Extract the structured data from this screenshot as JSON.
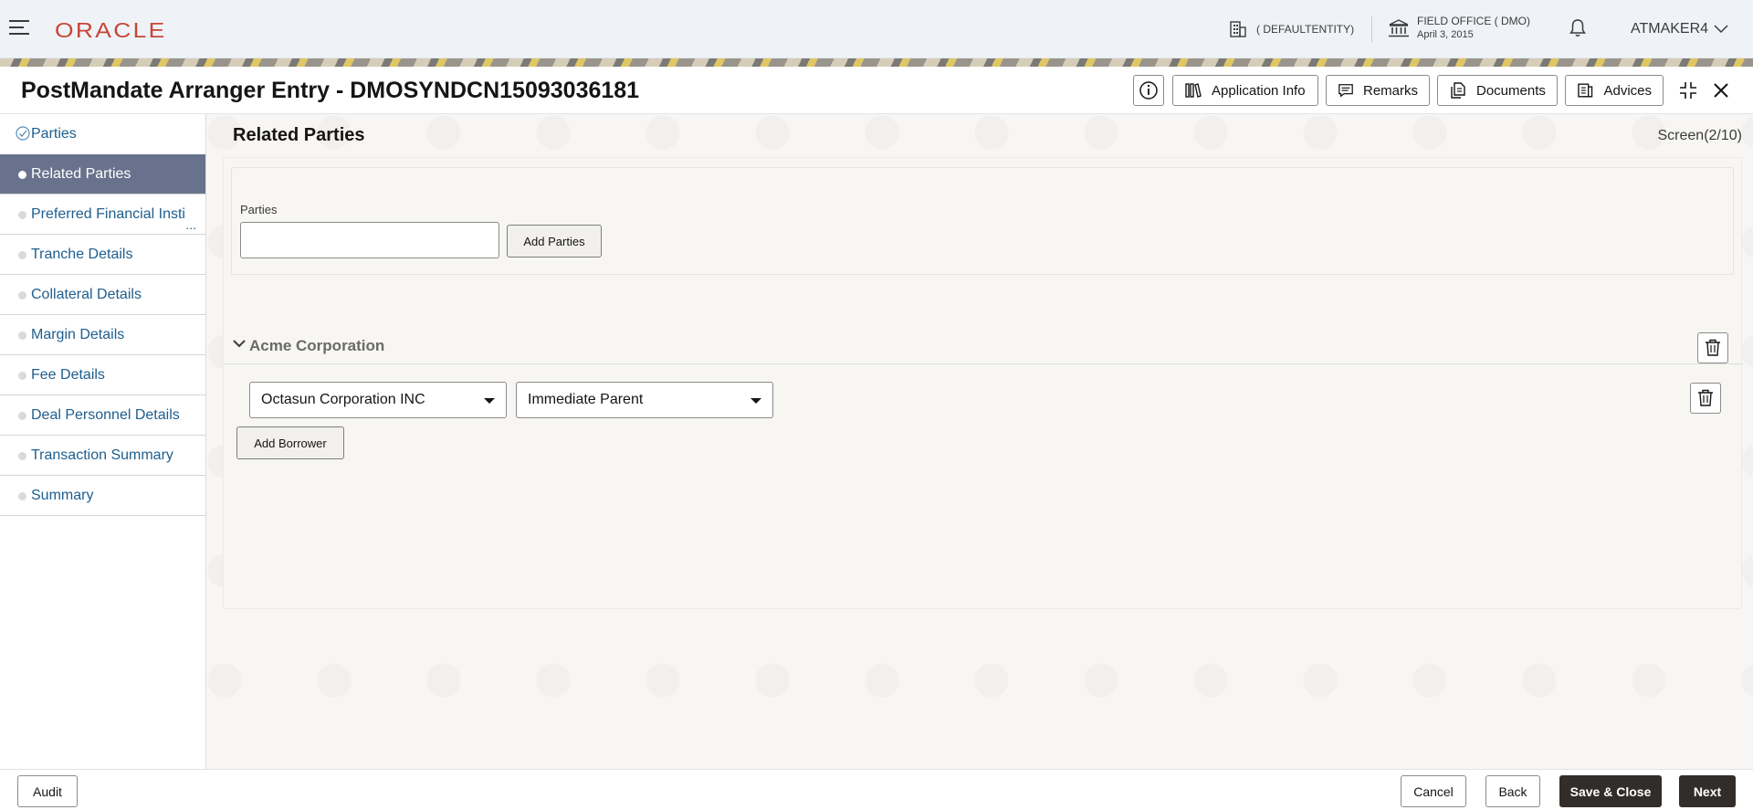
{
  "header": {
    "logo": "ORACLE",
    "entity": "( DEFAULTENTITY)",
    "office_name": "FIELD OFFICE ( DMO)",
    "office_date": "April 3, 2015",
    "user": "ATMAKER4"
  },
  "titlebar": {
    "title": "PostMandate Arranger Entry - DMOSYNDCN15093036181",
    "buttons": {
      "application_info": "Application Info",
      "remarks": "Remarks",
      "documents": "Documents",
      "advices": "Advices"
    }
  },
  "nav": {
    "items": [
      {
        "label": "Parties",
        "state": "completed"
      },
      {
        "label": "Related Parties",
        "state": "active"
      },
      {
        "label": "Preferred Financial Insti",
        "state": "pending"
      },
      {
        "label": "Tranche Details",
        "state": "pending"
      },
      {
        "label": "Collateral Details",
        "state": "pending"
      },
      {
        "label": "Margin Details",
        "state": "pending"
      },
      {
        "label": "Fee Details",
        "state": "pending"
      },
      {
        "label": "Deal Personnel Details",
        "state": "pending"
      },
      {
        "label": "Transaction Summary",
        "state": "pending"
      },
      {
        "label": "Summary",
        "state": "pending"
      }
    ],
    "overflow": "..."
  },
  "main": {
    "section_title": "Related Parties",
    "screen_count": "Screen(2/10)",
    "parties_label": "Parties",
    "parties_value": "",
    "add_parties": "Add Parties",
    "accordion_title": "Acme Corporation",
    "relation_party": "Octasun Corporation INC",
    "relation_type": "Immediate Parent",
    "add_borrower": "Add Borrower"
  },
  "footer": {
    "audit": "Audit",
    "cancel": "Cancel",
    "back": "Back",
    "save_close": "Save & Close",
    "next": "Next"
  },
  "colors": {
    "brand": "#c74634",
    "active_nav": "#69728c",
    "link": "#1e5e8e",
    "primary_button": "#312d2a"
  }
}
